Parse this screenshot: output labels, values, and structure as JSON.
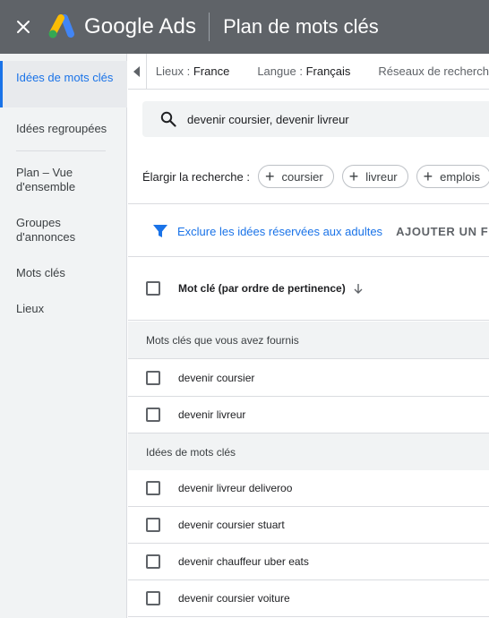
{
  "topbar": {
    "product_name": "Google Ads",
    "page_title": "Plan de mots clés"
  },
  "sidebar": {
    "items": [
      {
        "label": "Idées de mots clés",
        "active": true
      },
      {
        "label": "Idées regroupées"
      },
      {
        "label": "Plan – Vue d'ensemble"
      },
      {
        "label": "Groupes d'annonces"
      },
      {
        "label": "Mots clés"
      },
      {
        "label": "Lieux"
      }
    ]
  },
  "filters": {
    "locations_label": "Lieux :",
    "locations_value": "France",
    "language_label": "Langue :",
    "language_value": "Français",
    "networks_label": "Réseaux de recherch"
  },
  "search": {
    "query": "devenir coursier, devenir livreur"
  },
  "broaden": {
    "label": "Élargir la recherche :",
    "chips": [
      "coursier",
      "livreur",
      "emplois"
    ]
  },
  "filter_row": {
    "exclude_adult_link": "Exclure les idées réservées aux adultes",
    "add_filter": "AJOUTER UN FI"
  },
  "table": {
    "column_header": "Mot clé (par ordre de pertinence)",
    "groups": [
      {
        "title": "Mots clés que vous avez fournis",
        "rows": [
          "devenir coursier",
          "devenir livreur"
        ]
      },
      {
        "title": "Idées de mots clés",
        "rows": [
          "devenir livreur deliveroo",
          "devenir coursier stuart",
          "devenir chauffeur uber eats",
          "devenir coursier voiture"
        ]
      }
    ]
  },
  "colors": {
    "topbar": "#5f6368",
    "accent": "#1a73e8",
    "sidebar_bg": "#f1f3f4"
  }
}
